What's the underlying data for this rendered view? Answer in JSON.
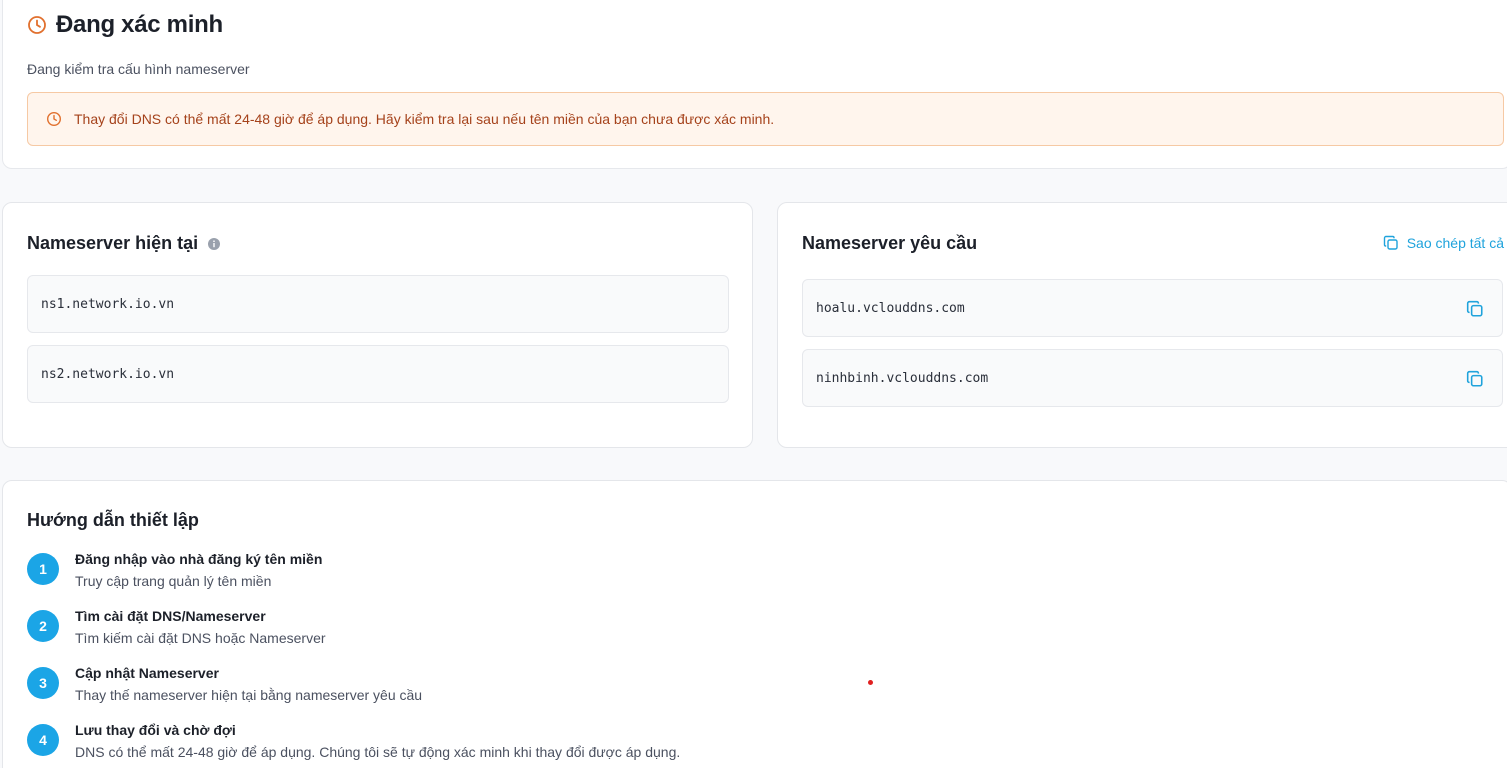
{
  "status": {
    "title": "Đang xác minh",
    "subtitle": "Đang kiểm tra cấu hình nameserver",
    "alert": "Thay đổi DNS có thể mất 24-48 giờ để áp dụng. Hãy kiểm tra lại sau nếu tên miền của bạn chưa được xác minh.",
    "icon": "clock-icon",
    "accent_color": "#e1702e"
  },
  "current_ns": {
    "title": "Nameserver hiện tại",
    "icon": "info-icon",
    "items": [
      "ns1.network.io.vn",
      "ns2.network.io.vn"
    ]
  },
  "required_ns": {
    "title": "Nameserver yêu cầu",
    "copy_all_label": "Sao chép tất cả",
    "icon": "copy-icon",
    "items": [
      "hoalu.vclouddns.com",
      "ninhbinh.vclouddns.com"
    ]
  },
  "guide": {
    "title": "Hướng dẫn thiết lập",
    "steps": [
      {
        "num": "1",
        "title": "Đăng nhập vào nhà đăng ký tên miền",
        "desc": "Truy cập trang quản lý tên miền"
      },
      {
        "num": "2",
        "title": "Tìm cài đặt DNS/Nameserver",
        "desc": "Tìm kiếm cài đặt DNS hoặc Nameserver"
      },
      {
        "num": "3",
        "title": "Cập nhật Nameserver",
        "desc": "Thay thế nameserver hiện tại bằng nameserver yêu cầu"
      },
      {
        "num": "4",
        "title": "Lưu thay đổi và chờ đợi",
        "desc": "DNS có thể mất 24-48 giờ để áp dụng. Chúng tôi sẽ tự động xác minh khi thay đổi được áp dụng."
      }
    ]
  },
  "colors": {
    "primary": "#1ba5e6",
    "link": "#1fa3dc",
    "alert_bg": "#fff5ed",
    "alert_text": "#a5421b"
  }
}
